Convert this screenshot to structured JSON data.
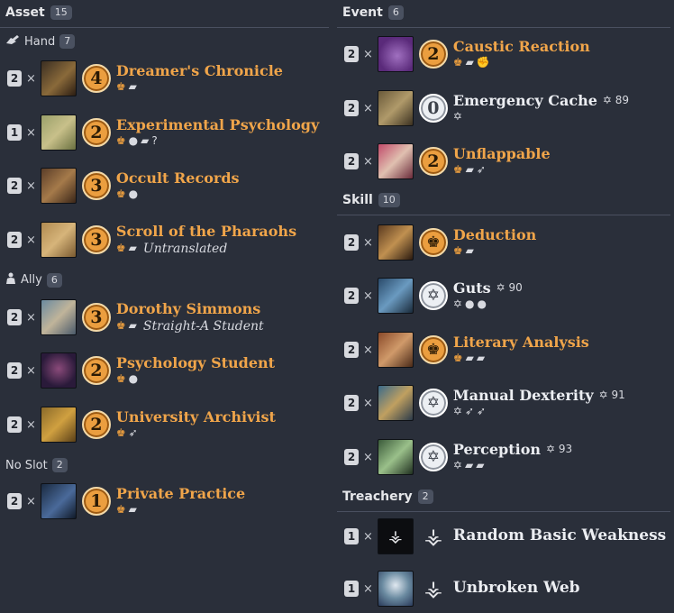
{
  "left": {
    "asset_header": {
      "label": "Asset",
      "count": "15"
    },
    "hand_header": {
      "icon": "hand-icon",
      "label": "Hand",
      "count": "7"
    },
    "ally_header": {
      "icon": "ally-icon",
      "label": "Ally",
      "count": "6"
    },
    "noslot_header": {
      "label": "No Slot",
      "count": "2"
    },
    "cards": [
      {
        "qty": "2",
        "cost": "4",
        "name": "Dreamer's Chronicle",
        "subtitle": "",
        "icons": [
          "willpower",
          "book"
        ]
      },
      {
        "qty": "1",
        "cost": "2",
        "name": "Experimental Psychology",
        "subtitle": "",
        "icons": [
          "willpower",
          "intellect",
          "book",
          "wild"
        ]
      },
      {
        "qty": "2",
        "cost": "3",
        "name": "Occult Records",
        "subtitle": "",
        "icons": [
          "willpower",
          "intellect"
        ]
      },
      {
        "qty": "2",
        "cost": "3",
        "name": "Scroll of the Pharaohs",
        "subtitle": "Untranslated",
        "icons": [
          "willpower",
          "book"
        ]
      },
      {
        "qty": "2",
        "cost": "3",
        "name": "Dorothy Simmons",
        "subtitle": "Straight-A Student",
        "icons": [
          "willpower",
          "book"
        ]
      },
      {
        "qty": "2",
        "cost": "2",
        "name": "Psychology Student",
        "subtitle": "",
        "icons": [
          "willpower",
          "intellect"
        ]
      },
      {
        "qty": "2",
        "cost": "2",
        "name": "University Archivist",
        "subtitle": "",
        "icons": [
          "willpower",
          "agility"
        ]
      },
      {
        "qty": "2",
        "cost": "1",
        "name": "Private Practice",
        "subtitle": "",
        "icons": [
          "willpower",
          "book"
        ]
      }
    ]
  },
  "right": {
    "event_header": {
      "label": "Event",
      "count": "6"
    },
    "skill_header": {
      "label": "Skill",
      "count": "10"
    },
    "treachery_header": {
      "label": "Treachery",
      "count": "2"
    },
    "events": [
      {
        "qty": "2",
        "cost": "2",
        "name": "Caustic Reaction",
        "xp": "",
        "icons": [
          "willpower",
          "book",
          "combat"
        ]
      },
      {
        "qty": "2",
        "cost": "0",
        "name": "Emergency Cache",
        "xp": "89",
        "icons": [
          "neutral"
        ]
      },
      {
        "qty": "2",
        "cost": "2",
        "name": "Unflappable",
        "xp": "",
        "icons": [
          "willpower",
          "book",
          "agility"
        ]
      }
    ],
    "skills": [
      {
        "qty": "2",
        "name": "Deduction",
        "xp": "",
        "icons": [
          "willpower",
          "book"
        ]
      },
      {
        "qty": "2",
        "name": "Guts",
        "xp": "90",
        "icons": [
          "neutral",
          "intellect",
          "intellect"
        ]
      },
      {
        "qty": "2",
        "name": "Literary Analysis",
        "xp": "",
        "icons": [
          "willpower",
          "book",
          "book"
        ]
      },
      {
        "qty": "2",
        "name": "Manual Dexterity",
        "xp": "91",
        "icons": [
          "neutral",
          "agility",
          "agility"
        ]
      },
      {
        "qty": "2",
        "name": "Perception",
        "xp": "93",
        "icons": [
          "neutral",
          "book",
          "book"
        ]
      }
    ],
    "treacheries": [
      {
        "qty": "1",
        "name": "Random Basic Weakness"
      },
      {
        "qty": "1",
        "name": "Unbroken Web"
      }
    ]
  },
  "times_symbol": "×",
  "colors": {
    "background": "#2a2f3a",
    "accent": "#f0a54a",
    "cost_fill": "#eb9e3f"
  }
}
